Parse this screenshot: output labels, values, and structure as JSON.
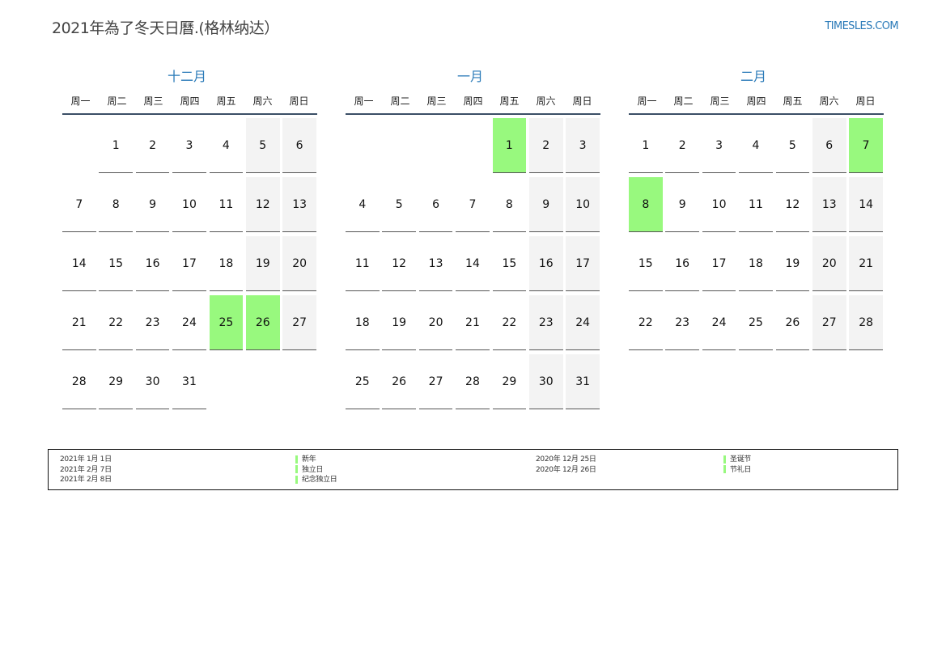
{
  "header": {
    "title": "2021年為了冬天日曆.(格林纳达）",
    "site": "TIMESLES.COM"
  },
  "colors": {
    "accent": "#2a7ab8",
    "holiday": "#98f97e",
    "weekend": "#f3f3f3"
  },
  "weekdays": [
    "周一",
    "周二",
    "周三",
    "周四",
    "周五",
    "周六",
    "周日"
  ],
  "months": [
    {
      "name": "十二月",
      "offset": 1,
      "days": 31,
      "holidays": [
        25,
        26
      ]
    },
    {
      "name": "一月",
      "offset": 4,
      "days": 31,
      "holidays": [
        1
      ]
    },
    {
      "name": "二月",
      "offset": 0,
      "days": 28,
      "holidays": [
        7,
        8
      ]
    }
  ],
  "legend": {
    "left": [
      {
        "date": "2021年 1月 1日",
        "name": "新年"
      },
      {
        "date": "2021年 2月 7日",
        "name": "独立日"
      },
      {
        "date": "2021年 2月 8日",
        "name": "纪念独立日"
      }
    ],
    "right": [
      {
        "date": "2020年 12月 25日",
        "name": "圣诞节"
      },
      {
        "date": "2020年 12月 26日",
        "name": "节礼日"
      }
    ]
  }
}
